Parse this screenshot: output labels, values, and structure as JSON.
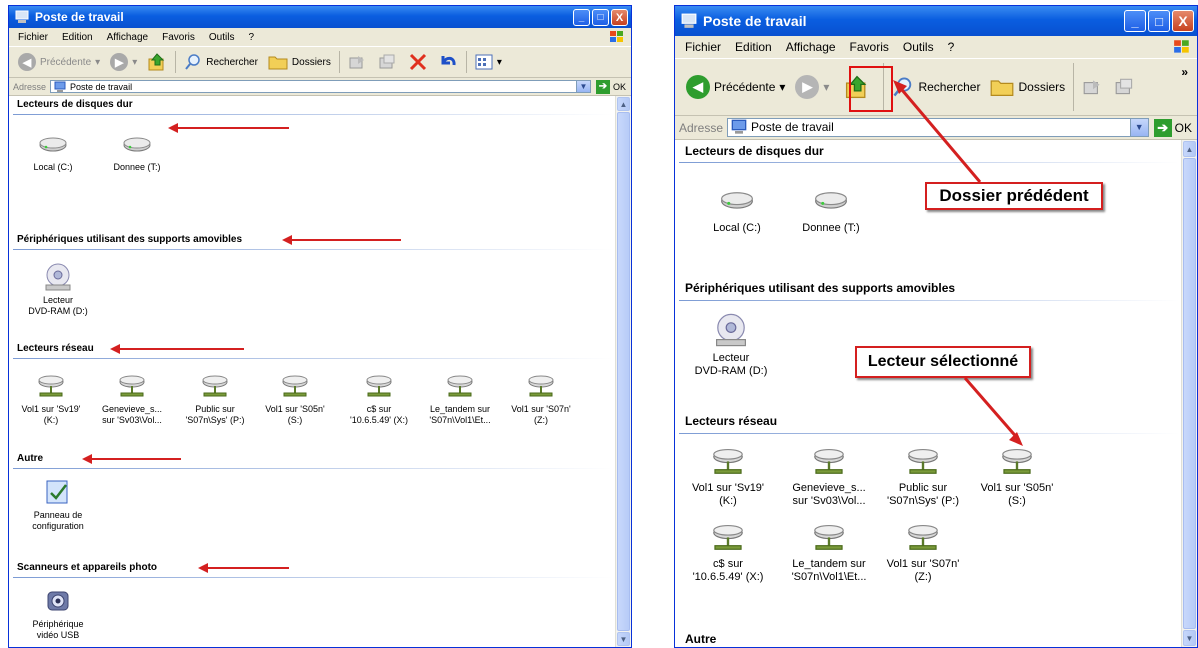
{
  "window": {
    "title": "Poste de travail",
    "menus": [
      "Fichier",
      "Edition",
      "Affichage",
      "Favoris",
      "Outils",
      "?"
    ],
    "back_label": "Précédente",
    "search_label": "Rechercher",
    "folders_label": "Dossiers",
    "address_label": "Adresse",
    "address_value": "Poste de travail",
    "go_label": "OK",
    "min_glyph": "_",
    "max_glyph": "□",
    "close_glyph": "X"
  },
  "sections": {
    "hard_drives": "Lecteurs de disques dur",
    "removable": "Périphériques utilisant des supports amovibles",
    "network": "Lecteurs réseau",
    "other": "Autre",
    "scanners": "Scanneurs et appareils photo"
  },
  "items": {
    "local_c": "Local (C:)",
    "donnee_t": "Donnee (T:)",
    "dvd_1": "Lecteur",
    "dvd_2": "DVD-RAM (D:)",
    "net": [
      [
        "Vol1 sur 'Sv19'",
        "(K:)"
      ],
      [
        "Genevieve_s...",
        "sur 'Sv03\\Vol..."
      ],
      [
        "Public sur",
        "'S07n\\Sys' (P:)"
      ],
      [
        "Vol1 sur 'S05n'",
        "(S:)"
      ],
      [
        "c$ sur",
        "'10.6.5.49' (X:)"
      ],
      [
        "Le_tandem sur",
        "'S07n\\Vol1\\Et..."
      ],
      [
        "Vol1 sur 'S07n'",
        "(Z:)"
      ]
    ],
    "panel_1": "Panneau de",
    "panel_2": "configuration",
    "usb_1": "Périphérique",
    "usb_2": "vidéo USB"
  },
  "annotations": {
    "previous_folder": "Dossier prédédent",
    "selected_drive": "Lecteur sélectionné"
  },
  "colors": {
    "title_blue": "#0a5ee0",
    "chrome": "#ece9d8",
    "arrow_red": "#d42020"
  }
}
